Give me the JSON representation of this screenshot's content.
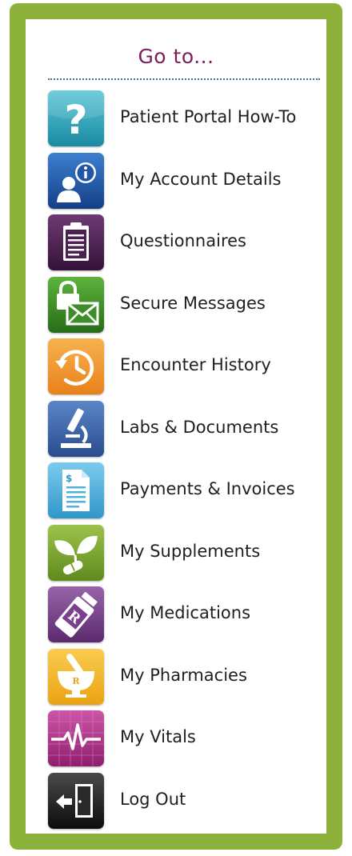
{
  "panel": {
    "title": "Go to..."
  },
  "menu": [
    {
      "label": "Patient Portal How-To",
      "icon": "question-icon",
      "color": "#2aa4b9"
    },
    {
      "label": "My Account Details",
      "icon": "account-info-icon",
      "color": "#1f56a8"
    },
    {
      "label": "Questionnaires",
      "icon": "clipboard-icon",
      "color": "#4c1f52"
    },
    {
      "label": "Secure Messages",
      "icon": "secure-envelope-icon",
      "color": "#3d8e28"
    },
    {
      "label": "Encounter History",
      "icon": "history-clock-icon",
      "color": "#f2962b"
    },
    {
      "label": "Labs & Documents",
      "icon": "microscope-icon",
      "color": "#3b63ab"
    },
    {
      "label": "Payments & Invoices",
      "icon": "invoice-icon",
      "color": "#4fb3de"
    },
    {
      "label": "My Supplements",
      "icon": "supplement-leaf-icon",
      "color": "#7fa82d"
    },
    {
      "label": "My Medications",
      "icon": "medication-bottle-icon",
      "color": "#7a3f8d"
    },
    {
      "label": "My Pharmacies",
      "icon": "mortar-pestle-icon",
      "color": "#f2b82a"
    },
    {
      "label": "My Vitals",
      "icon": "heartbeat-icon",
      "color": "#b2338a"
    },
    {
      "label": "Log Out",
      "icon": "logout-icon",
      "color": "#1a1a1a"
    }
  ]
}
